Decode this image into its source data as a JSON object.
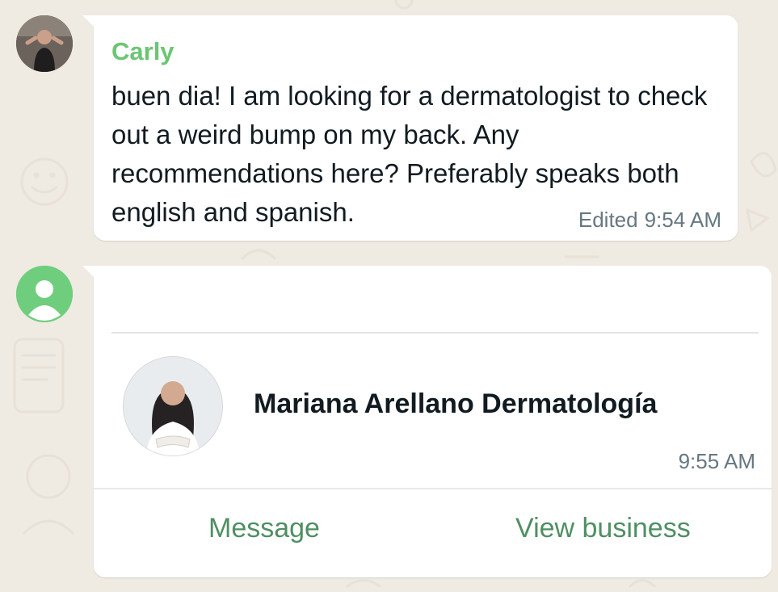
{
  "messages": [
    {
      "sender": "Carly",
      "text": "buen dia! I am looking for a dermatologist to check out a weird bump on my back. Any recommendations here? Preferably speaks both english and spanish.",
      "edited_label": "Edited",
      "time": "9:54 AM"
    }
  ],
  "business_card": {
    "name": "Mariana Arellano Dermatología",
    "time": "9:55 AM",
    "actions": {
      "message": "Message",
      "view_business": "View business"
    }
  },
  "colors": {
    "chat_background": "#efeae2",
    "bubble": "#ffffff",
    "sender_name": "#6bc673",
    "action_text": "#4f8f63",
    "meta_text": "#667781",
    "default_avatar": "#6fce7d"
  },
  "icons": {
    "default_avatar": "person-icon"
  }
}
